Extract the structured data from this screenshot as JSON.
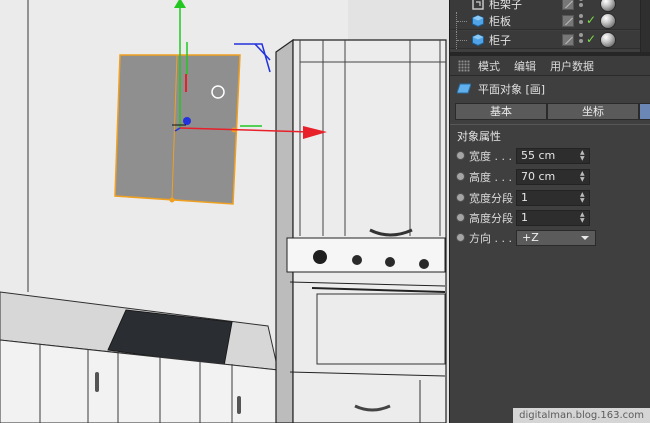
{
  "objects": [
    {
      "name": "柜架子",
      "icon": "object-icon"
    },
    {
      "name": "柜板",
      "icon": "cube-icon"
    },
    {
      "name": "柜子",
      "icon": "cube-icon"
    }
  ],
  "menu": {
    "items": [
      "模式",
      "编辑",
      "用户数据"
    ]
  },
  "object_header": {
    "title": "平面对象 [画]",
    "icon": "plane-object-icon"
  },
  "tabs": [
    {
      "label": "基本",
      "active": false
    },
    {
      "label": "坐标",
      "active": false
    },
    {
      "label": "",
      "active": true
    }
  ],
  "section": {
    "title": "对象属性"
  },
  "properties": {
    "width": {
      "label": "宽度 . . .",
      "value": "55 cm"
    },
    "height": {
      "label": "高度 . . .",
      "value": "70 cm"
    },
    "width_seg": {
      "label": "宽度分段",
      "value": "1"
    },
    "height_seg": {
      "label": "高度分段",
      "value": "1"
    },
    "direction": {
      "label": "方向 . . .",
      "value": "+Z"
    }
  },
  "watermark": "digitalman.blog.163.com",
  "colors": {
    "panel_bg": "#3f3f3f",
    "tab_active": "#6a87b5",
    "check_green": "#7fdc4a",
    "axis_x": "#e8202a",
    "axis_y": "#22c722",
    "axis_z": "#2233dd",
    "selection_orange": "#f0a020",
    "plane_fill": "#8f8f8f"
  }
}
